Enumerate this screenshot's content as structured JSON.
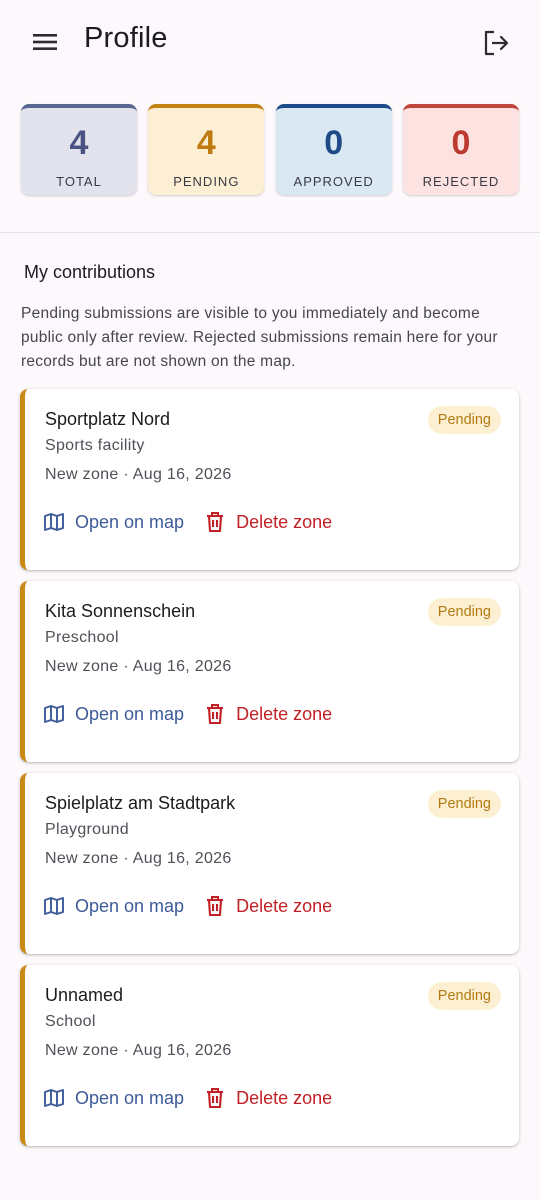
{
  "appbar": {
    "title": "Profile"
  },
  "stats": [
    {
      "value": "4",
      "label": "TOTAL",
      "color": "#4A5384",
      "bg": "#E3E3EE",
      "border": "#5A6790"
    },
    {
      "value": "4",
      "label": "PENDING",
      "color": "#C07A10",
      "bg": "#FDEFD3",
      "border": "#C48214"
    },
    {
      "value": "0",
      "label": "APPROVED",
      "color": "#1F4A88",
      "bg": "#D9E8F3",
      "border": "#1E4B8A"
    },
    {
      "value": "0",
      "label": "REJECTED",
      "color": "#BD3A30",
      "bg": "#FCE3E1",
      "border": "#C0453A"
    }
  ],
  "section": {
    "title": "My contributions",
    "description": "Pending submissions are visible to you immediately and become public only after review. Rejected submissions remain here for your records but are not shown on the map."
  },
  "cards": [
    {
      "name": "Sportplatz Nord",
      "type": "Sports facility",
      "meta": "New zone · Aug 16, 2026",
      "status": "Pending",
      "open_label": "Open on map",
      "delete_label": "Delete zone"
    },
    {
      "name": "Kita Sonnenschein",
      "type": "Preschool",
      "meta": "New zone · Aug 16, 2026",
      "status": "Pending",
      "open_label": "Open on map",
      "delete_label": "Delete zone"
    },
    {
      "name": "Spielplatz am Stadtpark",
      "type": "Playground",
      "meta": "New zone · Aug 16, 2026",
      "status": "Pending",
      "open_label": "Open on map",
      "delete_label": "Delete zone"
    },
    {
      "name": "Unnamed",
      "type": "School",
      "meta": "New zone · Aug 16, 2026",
      "status": "Pending",
      "open_label": "Open on map",
      "delete_label": "Delete zone"
    }
  ],
  "colors": {
    "accent_pending": "#C98A17",
    "action_open": "#3D5A99",
    "action_delete": "#C21F26"
  },
  "icons": {
    "menu": "hamburger-menu-icon",
    "logout": "logout-icon",
    "map": "map-icon",
    "delete": "trash-icon"
  }
}
